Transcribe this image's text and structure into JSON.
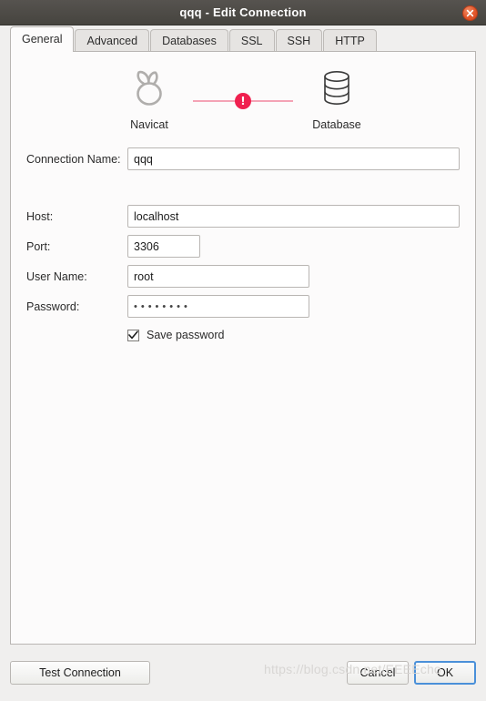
{
  "window": {
    "title": "qqq - Edit Connection",
    "close_icon": "close-icon"
  },
  "tabs": [
    {
      "label": "General",
      "active": true
    },
    {
      "label": "Advanced",
      "active": false
    },
    {
      "label": "Databases",
      "active": false
    },
    {
      "label": "SSL",
      "active": false
    },
    {
      "label": "SSH",
      "active": false
    },
    {
      "label": "HTTP",
      "active": false
    }
  ],
  "diagram": {
    "source_label": "Navicat",
    "source_icon": "navicat-logo-icon",
    "target_label": "Database",
    "target_icon": "database-cylinder-icon",
    "status_icon": "error-exclamation-icon",
    "status_color": "#f0204f",
    "line_color": "#f4a3b5"
  },
  "form": {
    "connection_name": {
      "label": "Connection Name:",
      "value": "qqq",
      "placeholder": ""
    },
    "host": {
      "label": "Host:",
      "value": "localhost",
      "placeholder": ""
    },
    "port": {
      "label": "Port:",
      "value": "3306",
      "placeholder": ""
    },
    "user_name": {
      "label": "User Name:",
      "value": "root",
      "placeholder": ""
    },
    "password": {
      "label": "Password:",
      "value": "••••••••",
      "placeholder": ""
    },
    "save_password": {
      "label": "Save password",
      "checked": true
    }
  },
  "buttons": {
    "test_connection": "Test Connection",
    "cancel": "Cancel",
    "ok": "OK"
  },
  "watermark": {
    "text": "https://blog.csdn.net/EEEEcho"
  },
  "colors": {
    "titlebar": "#4a4845",
    "close_button": "#e2562a",
    "focus_border": "#4a90d9",
    "panel_bg": "#fcfbfb",
    "window_bg": "#f0efee"
  }
}
